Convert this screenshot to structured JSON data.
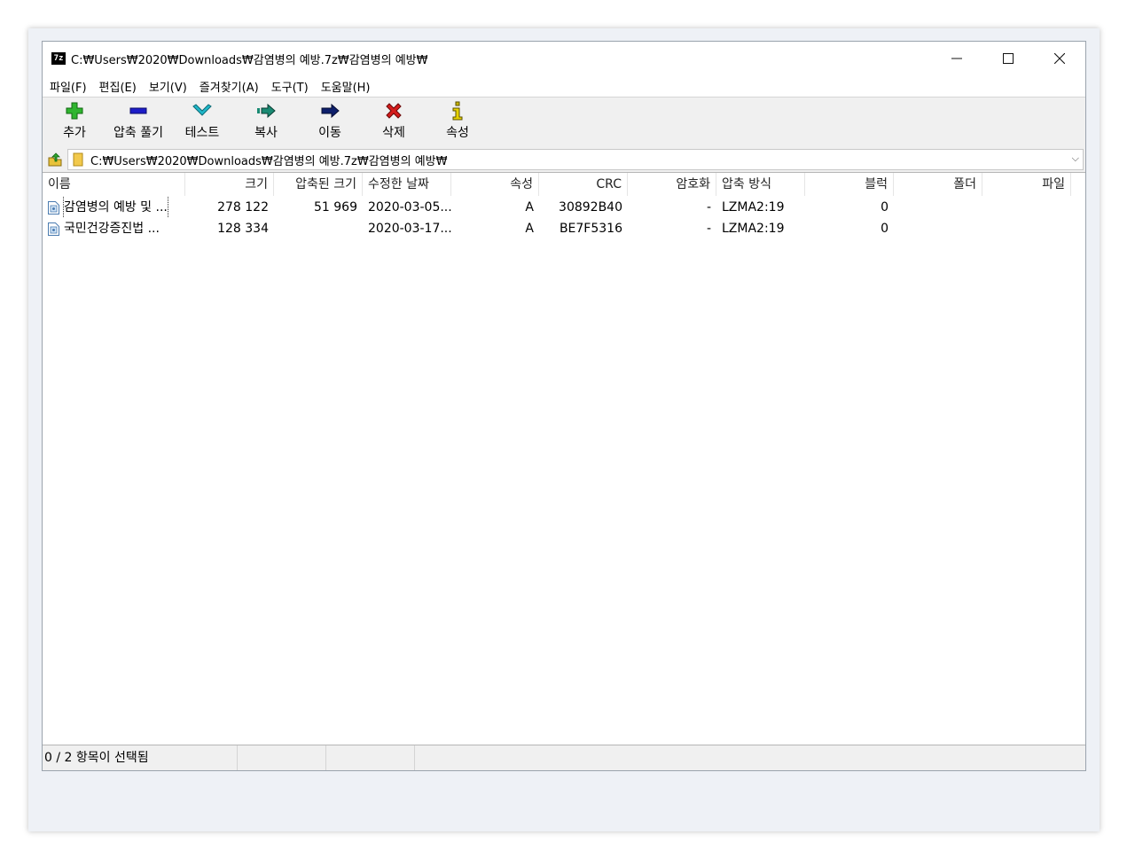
{
  "window": {
    "app_icon": "7z",
    "title": "C:₩Users₩2020₩Downloads₩감염병의 예방.7z₩감염병의 예방₩",
    "minimize_glyph": "—",
    "maximize_glyph": "☐",
    "close_glyph": "✕"
  },
  "menu": [
    "파일(F)",
    "편집(E)",
    "보기(V)",
    "즐겨찾기(A)",
    "도구(T)",
    "도움말(H)"
  ],
  "toolbar": {
    "add": "추가",
    "extract": "압축 풀기",
    "test": "테스트",
    "copy": "복사",
    "move": "이동",
    "delete": "삭제",
    "info": "속성"
  },
  "address": {
    "path": "C:₩Users₩2020₩Downloads₩감염병의 예방.7z₩감염병의 예방₩",
    "dropdown_glyph": "⌵"
  },
  "columns": {
    "name": "이름",
    "size": "크기",
    "packed": "압축된 크기",
    "modified": "수정한 날짜",
    "attributes": "속성",
    "crc": "CRC",
    "encrypted": "암호화",
    "method": "압축 방식",
    "block": "블럭",
    "folders": "폴더",
    "files": "파일"
  },
  "rows": [
    {
      "name": "감염병의 예방 및 ...",
      "size": "278 122",
      "packed": "51 969",
      "modified": "2020-03-05...",
      "attributes": "A",
      "crc": "30892B40",
      "encrypted": "-",
      "method": "LZMA2:19",
      "block": "0"
    },
    {
      "name": "국민건강증진법 ...",
      "size": "128 334",
      "packed": "",
      "modified": "2020-03-17...",
      "attributes": "A",
      "crc": "BE7F5316",
      "encrypted": "-",
      "method": "LZMA2:19",
      "block": "0"
    }
  ],
  "status": {
    "selection": "0 / 2 항목이 선택됨"
  },
  "colors": {
    "add_icon": "#2fb52f",
    "extract_icon": "#1d1dc8",
    "test_icon": "#1fb7c9",
    "copy_icon": "#1a8a73",
    "move_icon": "#0d1f6b",
    "delete_icon": "#d41c1c",
    "info_icon": "#c8b400"
  }
}
